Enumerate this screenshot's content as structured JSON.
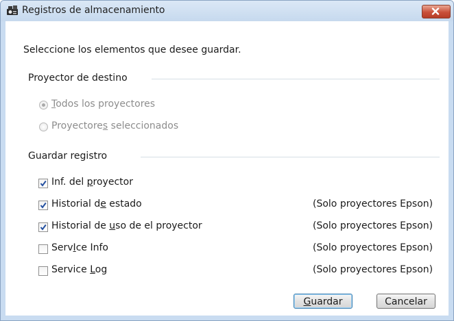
{
  "window": {
    "title": "Registros de almacenamiento",
    "title_icon": "projector-log-icon",
    "close_icon": "close-icon"
  },
  "instruction": "Seleccione los elementos que desee guardar.",
  "target_group": {
    "title": "Proyector de destino",
    "options": [
      {
        "pre": "",
        "mnemonic": "T",
        "post": "odos los proyectores",
        "selected": true,
        "enabled": false
      },
      {
        "pre": "Proyectore",
        "mnemonic": "s",
        "post": " seleccionados",
        "selected": false,
        "enabled": false
      }
    ]
  },
  "log_group": {
    "title": "Guardar registro",
    "items": [
      {
        "pre": "Inf. del ",
        "mnemonic": "p",
        "post": "royector",
        "checked": true,
        "note": ""
      },
      {
        "pre": "Historial d",
        "mnemonic": "e",
        "post": " estado",
        "checked": true,
        "note": "(Solo proyectores Epson)"
      },
      {
        "pre": "Historial de ",
        "mnemonic": "u",
        "post": "so de el proyector",
        "checked": true,
        "note": "(Solo proyectores Epson)"
      },
      {
        "pre": "Serv",
        "mnemonic": "I",
        "post": "ce Info",
        "checked": false,
        "note": "(Solo proyectores Epson)"
      },
      {
        "pre": "Service ",
        "mnemonic": "L",
        "post": "og",
        "checked": false,
        "note": "(Solo proyectores Epson)"
      }
    ]
  },
  "buttons": {
    "save": {
      "pre": "",
      "mnemonic": "G",
      "post": "uardar"
    },
    "cancel": {
      "label": "Cancelar"
    }
  }
}
